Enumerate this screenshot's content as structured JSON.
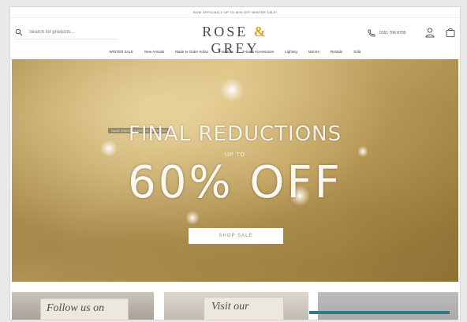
{
  "topbar": {
    "text": "NOW OFFICIALLY UP TO 60% OFF WINTER SALE!"
  },
  "search": {
    "placeholder": "Search for products..."
  },
  "logo": {
    "left": "ROSE",
    "amp": "&",
    "right": "GREY"
  },
  "header": {
    "phone": "0161 706 8700",
    "account_icon": "user-icon",
    "basket_icon": "bag-icon"
  },
  "nav": {
    "items": [
      "WINTER SALE",
      "New Arrivals",
      "Made to Order Sofas",
      "Furniture",
      "Home Accessories",
      "Lighting",
      "Mirrors",
      "Rentals",
      "Sofa"
    ]
  },
  "hero": {
    "small_label": "SALE ENDS THURSDAY MIDNIGHT",
    "title": "FINAL REDUCTIONS",
    "upto": "UP TO",
    "big": "60% OFF",
    "cta": "SHOP SALE"
  },
  "tiles": [
    {
      "text": "Follow us on"
    },
    {
      "text": "Visit our"
    },
    {
      "text": ""
    }
  ],
  "colors": {
    "accent": "#d6a728",
    "teal": "#2f7d82"
  }
}
